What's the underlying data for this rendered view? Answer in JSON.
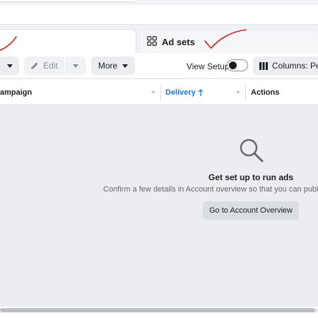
{
  "tabs": {
    "adsets_label": "Ad sets"
  },
  "toolbar": {
    "edit_label": "Edit",
    "more_label": "More",
    "view_setup_label": "View Setup",
    "columns_label": "Columns: Perf"
  },
  "table": {
    "headers": {
      "campaign": "ampaign",
      "delivery": "Delivery",
      "actions": "Actions"
    }
  },
  "empty_state": {
    "title": "Get set up to run ads",
    "description": "Confirm a few details in Account overview so that you can publish",
    "button_label": "Go to Account Overview"
  },
  "colors": {
    "accent_blue": "#1877f2",
    "annotation_red": "#e41e1e",
    "empty_bg": "#ebedf0"
  },
  "icons": {
    "adsets": "grid-icon",
    "edit": "pencil-icon",
    "columns": "columns-icon",
    "search": "magnifier-icon",
    "sort": "arrow-up-icon"
  },
  "toggle_state": "off"
}
